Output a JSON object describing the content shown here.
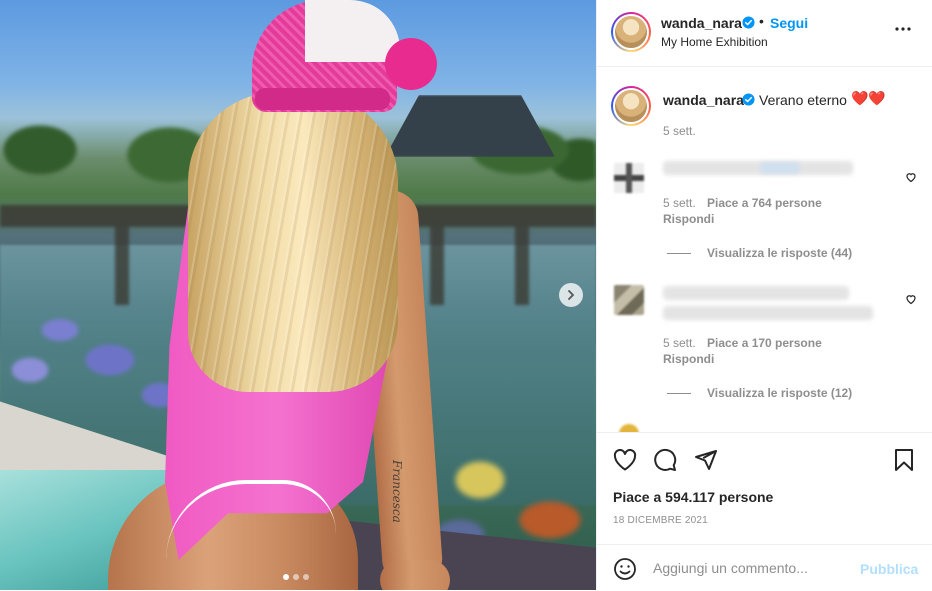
{
  "post": {
    "author": {
      "username": "wanda_nara",
      "follow_label": "Segui",
      "separator": "•",
      "location": "My Home Exhibition"
    },
    "caption": {
      "username": "wanda_nara",
      "text": "Verano eterno",
      "emoji": "❤️❤️",
      "time": "5 sett."
    },
    "comments": [
      {
        "time": "5 sett.",
        "likes": "Piace a 764 persone",
        "reply_label": "Rispondi",
        "view_replies": "Visualizza le risposte (44)"
      },
      {
        "time": "5 sett.",
        "likes": "Piace a 170 persone",
        "reply_label": "Rispondi",
        "view_replies": "Visualizza le risposte (12)"
      }
    ],
    "likes_total": "Piace a 594.117 persone",
    "date": "18 DICEMBRE 2021",
    "comment_placeholder": "Aggiungi un commento...",
    "publish_label": "Pubblica",
    "tattoo_text": "Francesca"
  },
  "carousel": {
    "slide_count": 3,
    "active_index": 0
  },
  "colors": {
    "accent_blue": "#0095f6",
    "publish_disabled": "#b2dffc",
    "text": "#262626",
    "muted": "#8e8e8e",
    "border": "#efefef"
  },
  "icons": [
    "chevron-right-icon",
    "more-options-icon",
    "verified-badge-icon",
    "heart-icon",
    "comment-icon",
    "share-icon",
    "bookmark-icon",
    "emoji-icon"
  ]
}
